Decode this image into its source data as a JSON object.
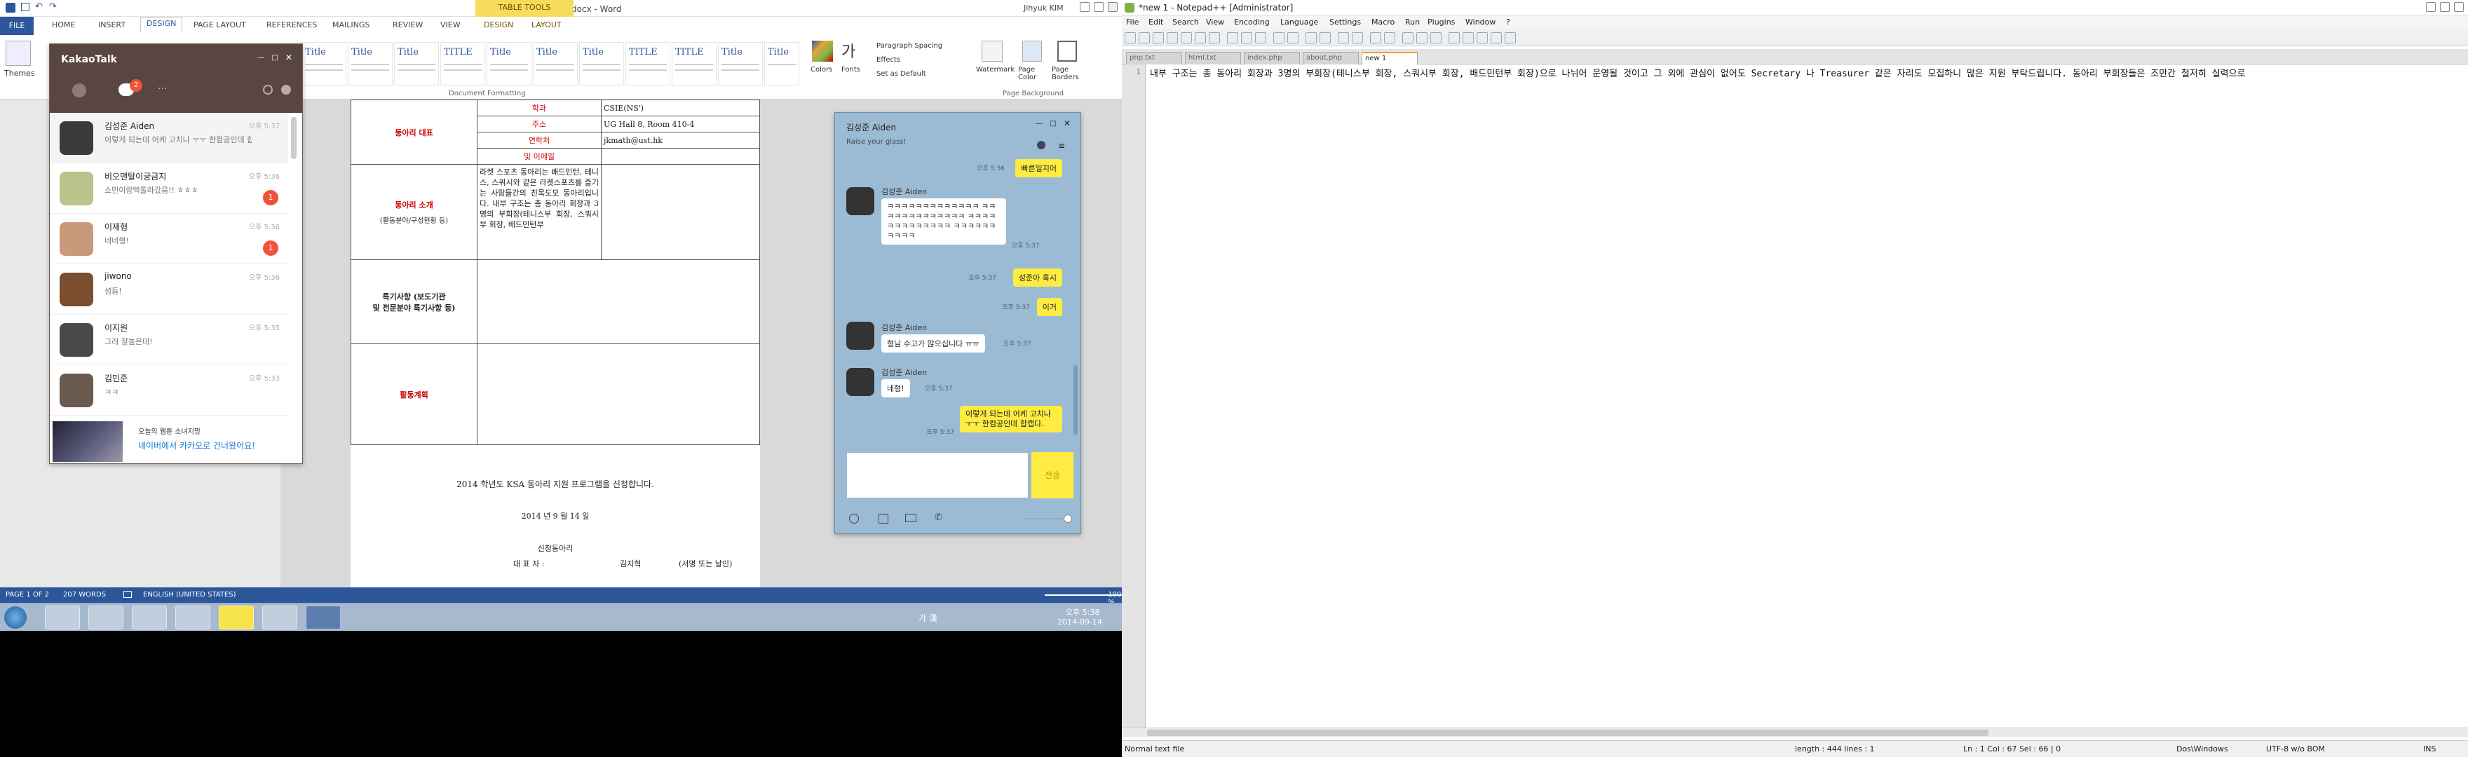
{
  "word": {
    "title": "KSA 동아리 신청서.docx - Word",
    "table_tools": "TABLE TOOLS",
    "user": "Jihyuk KIM",
    "tabs": [
      "FILE",
      "HOME",
      "INSERT",
      "DESIGN",
      "PAGE LAYOUT",
      "REFERENCES",
      "MAILINGS",
      "REVIEW",
      "VIEW"
    ],
    "tt_tabs": [
      "DESIGN",
      "LAYOUT"
    ],
    "ribbon": {
      "themes": "Themes",
      "styles": [
        "Title",
        "Title",
        "Title",
        "TITLE",
        "Title",
        "Title",
        "Title",
        "TITLE",
        "TITLE",
        "Title",
        "Title"
      ],
      "colors": "Colors",
      "fonts": "Fonts",
      "paragraph_spacing": "Paragraph Spacing",
      "effects": "Effects",
      "set_default": "Set as Default",
      "watermark": "Watermark",
      "page_color": "Page Color",
      "page_borders": "Page Borders",
      "group_doc_format": "Document Formatting",
      "group_page_bg": "Page Background"
    },
    "doc": {
      "rep_label": "동아리 대표",
      "rep_rows": [
        {
          "k": "학과",
          "v": "CSIE(NS')"
        },
        {
          "k": "주소",
          "v": "UG Hall 8, Room 410-4"
        },
        {
          "k": "연락처",
          "v": "jkmath@ust.hk"
        },
        {
          "k": "및 이메일",
          "v": ""
        }
      ],
      "intro_label": "동아리 소개",
      "intro_sub": "(활동분야/구성현황 등)",
      "intro_text": "라켓 스포츠 동아리는 배드민턴, 테니스, 스쿼시와 같은 라켓스포츠를 즐기는 사람들간의 친목도모 동아리입니다. 내부 구조는 총 동아리 회장과 3 명의 부회장(테니스부 회장, 스쿼시부 회장, 배드민턴부",
      "notes_label": "특기사항 (보도기관",
      "notes_sub": "및 전문분야 특기사항 등)",
      "plan_label": "활동계획",
      "apply_line": "2014 학년도 KSA 동아리 지원 프로그램을 신청합니다.",
      "date_line": "2014 년 9 월 14 일",
      "club_line": "신청동아리",
      "rep_line_a": "대  표  자 :",
      "rep_name": "김지혁",
      "sign_line": "(서명 또는 날인)"
    },
    "status": {
      "page": "PAGE 1 OF 2",
      "words": "207 WORDS",
      "lang": "ENGLISH (UNITED STATES)",
      "zoom": "100 %"
    }
  },
  "kakao": {
    "logo": "KakaoTalk",
    "badge": "2",
    "chats": [
      {
        "name": "김성준 Aiden",
        "msg": "이렇게 되는데 어케 고치나 ㅜㅜ 한컴공인데 합캡다...",
        "time": "오후 5:37",
        "badge": "",
        "color": "#3b3b3b"
      },
      {
        "name": "비오맨탈이궁금지",
        "msg": "소민이랑액톨라갔음!! ㅎㅎㅎ",
        "time": "오후 5:36",
        "badge": "1",
        "color": "#b8c48a"
      },
      {
        "name": "이재형",
        "msg": "네네형!",
        "time": "오후 5:36",
        "badge": "1",
        "color": "#c99a7a"
      },
      {
        "name": "jiwono",
        "msg": "셤듐!",
        "time": "오후 5:36",
        "badge": "",
        "color": "#7a4e2e"
      },
      {
        "name": "이지원",
        "msg": "그래 잘놀은데!",
        "time": "오후 5:35",
        "badge": "",
        "color": "#4a4a4a"
      },
      {
        "name": "김민준",
        "msg": "ㅋㅋ",
        "time": "오후 5:33",
        "badge": "",
        "color": "#6a5a50"
      }
    ],
    "ad_line1": "오늘의 웹툰   소녀지망",
    "ad_line2": "네이버에서 카카오로 건너왔어요!"
  },
  "chat": {
    "title": "김성준 Aiden",
    "status": "Raise your glass!",
    "msgs": {
      "top_me": "빠른일지어",
      "top_time": "오후 5:36",
      "aiden": "김성준 Aiden",
      "ke_block": "ㅋㅋㅋㅋㅋㅋㅋㅋㅋㅋㅋㅋㅋ ㅋㅋㅋㅋㅋㅋㅋㅋㅋㅋㅋㅋㅋ ㅋㅋㅋㅋㅋㅋㅋㅋㅋㅋㅋㅋㅋ ㅋㅋㅋㅋㅋㅋㅋㅋㅋㅋ",
      "ke_time": "오후 5:37",
      "me1": "성준아 혹시",
      "me1_time": "오후 5:37",
      "me2": "이거",
      "me2_time": "오후 5:37",
      "reply1": "형님 수고가 많으십니다 ㅠㅠ",
      "reply1_time": "오후 5:37",
      "reply2": "네형!",
      "reply2_time": "오후 5:37",
      "me3": "이렇게 되는데 어케 고치나 ㅜㅜ 한컴공인데 합캡다.",
      "me3_time": "오후 5:37"
    },
    "send": "전송"
  },
  "taskbar": {
    "ime": "가 漢",
    "time": "오후 5:38",
    "date": "2014-09-14"
  },
  "notepad": {
    "title": "*new 1 - Notepad++ [Administrator]",
    "menu": [
      "File",
      "Edit",
      "Search",
      "View",
      "Encoding",
      "Language",
      "Settings",
      "Macro",
      "Run",
      "Plugins",
      "Window",
      "?"
    ],
    "tabs": [
      "php.txt",
      "html.txt",
      "index.php",
      "about.php",
      "new 1"
    ],
    "line_no": "1",
    "line": "내부 구조는 총 동아리 회장과 3명의 부회장(테니스부 회장, 스쿼시부 회장, 배드민턴부 회장)으로 나뉘어 운영될 것이고 그 외에 관심이 없어도 Secretary 나 Treasurer 같은 자리도 모집하니 많은 지원 부탁드립니다. 동아리 부회장들은 조만간 철저히 실력으로",
    "status": {
      "type": "Normal text file",
      "length": "length : 444    lines : 1",
      "pos": "Ln : 1    Col : 67    Sel : 66 | 0",
      "eol": "Dos\\Windows",
      "enc": "UTF-8 w/o BOM",
      "ins": "INS"
    }
  }
}
